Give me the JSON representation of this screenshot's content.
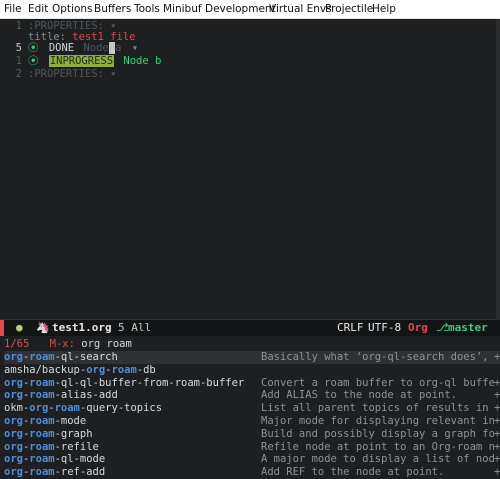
{
  "menubar": {
    "items": [
      "File",
      "Edit",
      "Options",
      "Buffers",
      "Tools",
      "Minibuf",
      "Development",
      "Virtual Envs",
      "Projectile",
      "Help"
    ]
  },
  "editor": {
    "lines": [
      {
        "num": "1",
        "text": ":PROPERTIES: ▾"
      },
      {
        "num": "",
        "key": "title:",
        "value": "test1 file"
      },
      {
        "num": "5",
        "bullet": "⦿",
        "todo": "DONE",
        "heading_before": "Node",
        "heading_cursor": " ",
        "heading_after": "a",
        "fold": "▾"
      },
      {
        "num": "1",
        "bullet": "⦿",
        "todo": "INPROGRESS",
        "heading": "Node b"
      },
      {
        "num": "2",
        "text": ":PROPERTIES: ▾"
      }
    ]
  },
  "modeline": {
    "buffer": "test1.org",
    "position": "5 All",
    "eol": "CRLF",
    "encoding": "UTF-8",
    "mode": "Org",
    "branch": "master"
  },
  "minibuffer": {
    "count": "1/65",
    "prompt": "M-x:",
    "input": "org roam",
    "candidates": [
      {
        "parts": [
          [
            "org",
            "m"
          ],
          [
            "-",
            ""
          ],
          [
            "roam",
            "m"
          ],
          [
            "-ql-search",
            ""
          ]
        ],
        "annotation": "Basically what ‘org-ql-search does’,"
      },
      {
        "parts": [
          [
            "amsha/backup-",
            ""
          ],
          [
            "org",
            "m"
          ],
          [
            "-",
            ""
          ],
          [
            "roam",
            "m"
          ],
          [
            "-db",
            ""
          ]
        ],
        "annotation": ""
      },
      {
        "parts": [
          [
            "org",
            "m"
          ],
          [
            "-",
            ""
          ],
          [
            "roam",
            "m"
          ],
          [
            "-ql-ql-buffer-from-roam-buffer",
            ""
          ]
        ],
        "annotation": "Convert a roam buffer to org-ql buffe"
      },
      {
        "parts": [
          [
            "org",
            "m"
          ],
          [
            "-",
            ""
          ],
          [
            "roam",
            "m"
          ],
          [
            "-alias-add",
            ""
          ]
        ],
        "annotation": "Add ALIAS to the node at point."
      },
      {
        "parts": [
          [
            "okm-",
            ""
          ],
          [
            "org",
            "m"
          ],
          [
            "-",
            ""
          ],
          [
            "roam",
            "m"
          ],
          [
            "-query-topics",
            ""
          ]
        ],
        "annotation": "List all parent topics of results in"
      },
      {
        "parts": [
          [
            "org",
            "m"
          ],
          [
            "-",
            ""
          ],
          [
            "roam",
            "m"
          ],
          [
            "-mode",
            ""
          ]
        ],
        "annotation": "Major mode for displaying relevant in"
      },
      {
        "parts": [
          [
            "org",
            "m"
          ],
          [
            "-",
            ""
          ],
          [
            "roam",
            "m"
          ],
          [
            "-graph",
            ""
          ]
        ],
        "annotation": "Build and possibly display a graph fo"
      },
      {
        "parts": [
          [
            "org",
            "m"
          ],
          [
            "-",
            ""
          ],
          [
            "roam",
            "m"
          ],
          [
            "-refile",
            ""
          ]
        ],
        "annotation": "Refile node at point to an Org-roam n"
      },
      {
        "parts": [
          [
            "org",
            "m"
          ],
          [
            "-",
            ""
          ],
          [
            "roam",
            "m"
          ],
          [
            "-ql-mode",
            ""
          ]
        ],
        "annotation": "A major mode to display a list of nod"
      },
      {
        "parts": [
          [
            "org",
            "m"
          ],
          [
            "-",
            ""
          ],
          [
            "roam",
            "m"
          ],
          [
            "-ref-add",
            ""
          ]
        ],
        "annotation": "Add REF to the node at point."
      }
    ]
  },
  "colors": {
    "background": "#1d1f21",
    "match": "#4f8fd9",
    "todo": "#33d17a",
    "keyword": "#e5484d",
    "inprogress_bg": "#8fae3f"
  }
}
